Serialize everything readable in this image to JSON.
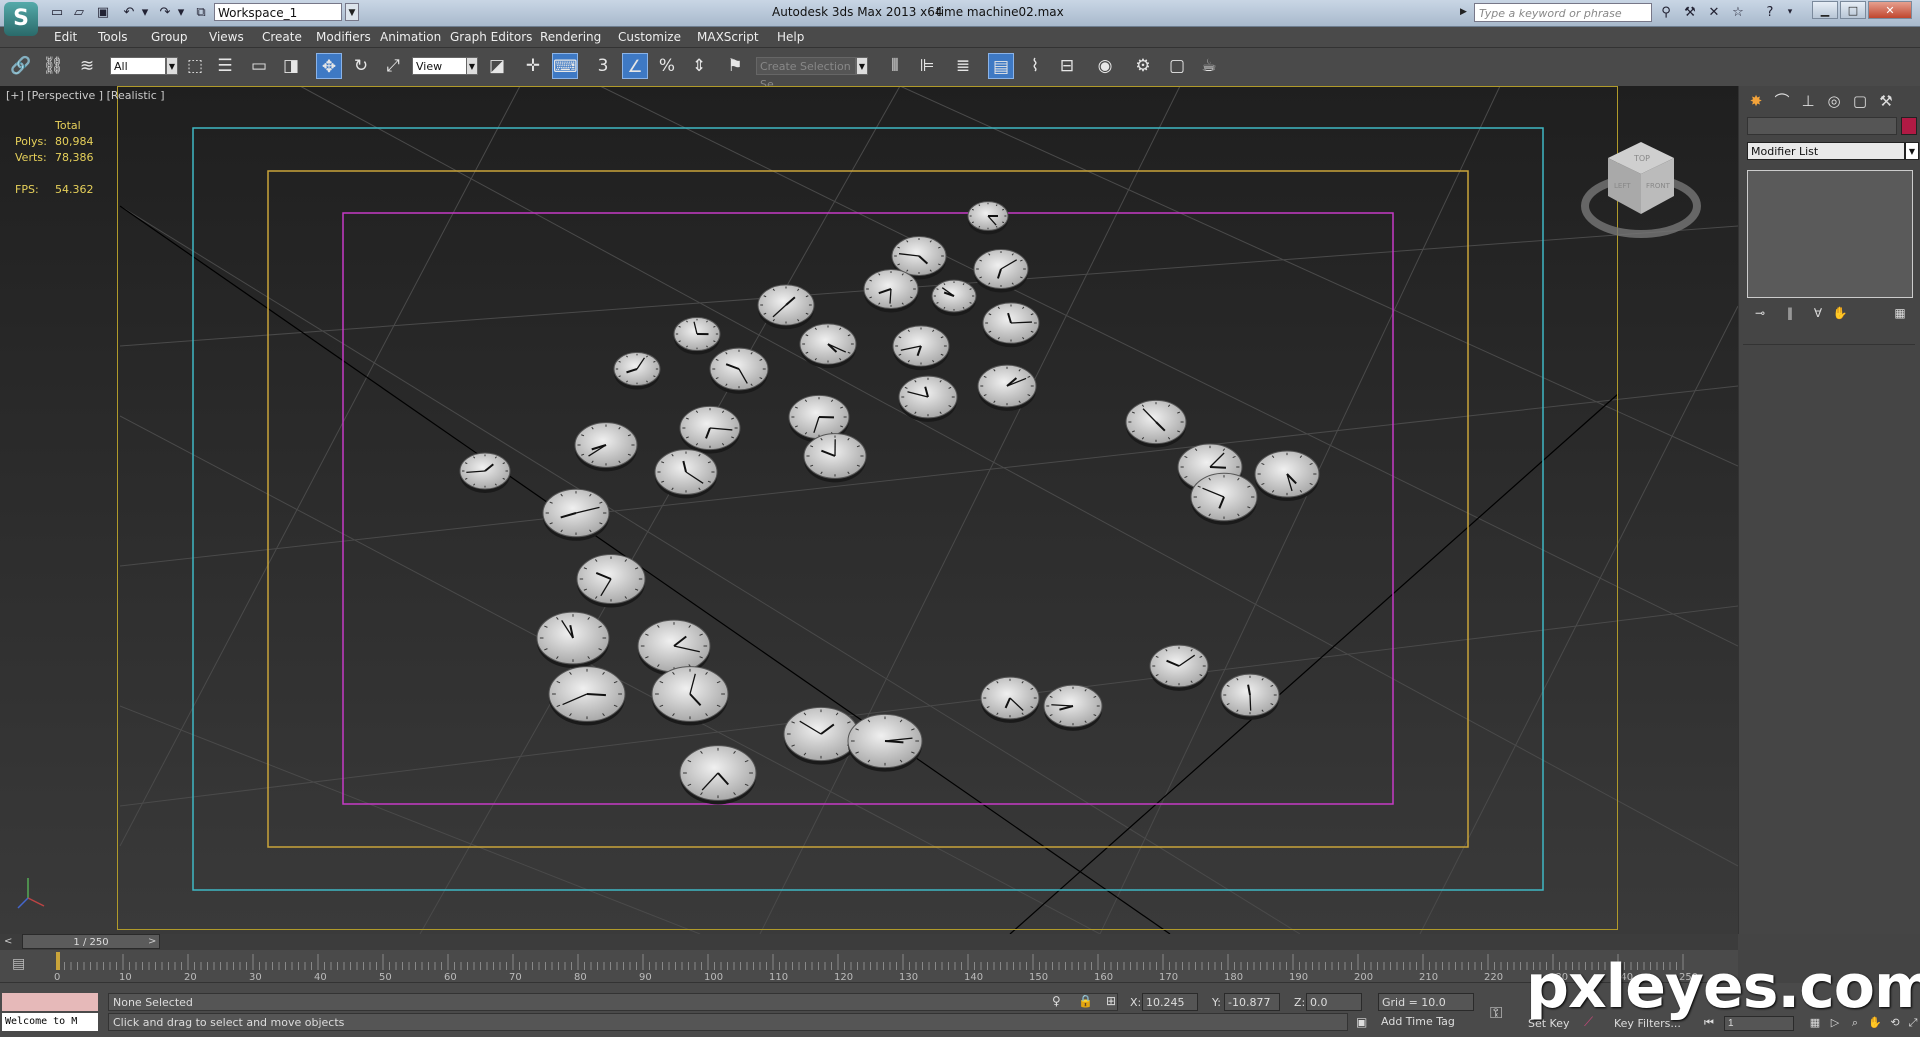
{
  "titlebar": {
    "workspace": "Workspace_1",
    "app_title": "Autodesk 3ds Max  2013 x64",
    "file_title": "time machine02.max",
    "search_placeholder": "Type a keyword or phrase"
  },
  "menu": [
    "Edit",
    "Tools",
    "Group",
    "Views",
    "Create",
    "Modifiers",
    "Animation",
    "Graph Editors",
    "Rendering",
    "Customize",
    "MAXScript",
    "Help"
  ],
  "toolbar": {
    "selection_filter": "All",
    "ref_coord": "View",
    "snap_angle_label": "3",
    "named_selection_placeholder": "Create Selection Se"
  },
  "viewport": {
    "label": "[+] [Perspective ] [Realistic ]",
    "stats": {
      "total_label": "Total",
      "polys_label": "Polys:",
      "polys_value": "80,984",
      "verts_label": "Verts:",
      "verts_value": "78,386",
      "fps_label": "FPS:",
      "fps_value": "54.362"
    },
    "viewcube": {
      "top": "TOP",
      "left": "LEFT",
      "front": "FRONT"
    }
  },
  "command_panel": {
    "modifier_list": "Modifier List"
  },
  "time_slider": {
    "position": "1 / 250",
    "prev": "<",
    "next": ">"
  },
  "trackbar": {
    "ticks": [
      "0",
      "10",
      "20",
      "30",
      "40",
      "50",
      "60",
      "70",
      "80",
      "90",
      "100",
      "110",
      "120",
      "130",
      "140",
      "150",
      "160",
      "170",
      "180",
      "190",
      "200",
      "210",
      "220",
      "230",
      "240",
      "250"
    ]
  },
  "status": {
    "listener_text": "Welcome to M",
    "selection": "None Selected",
    "prompt": "Click and drag to select and move objects",
    "x_label": "X:",
    "x_value": "10.245",
    "y_label": "Y:",
    "y_value": "-10.877",
    "z_label": "Z:",
    "z_value": "0.0",
    "grid": "Grid = 10.0",
    "add_time_tag": "Add Time Tag",
    "set_key": "Set Key",
    "key_filters": "Key Filters...",
    "current_frame": "1"
  },
  "watermark": "pxleyes.com",
  "colors": {
    "safe_frame_outer": "#3fb7c4",
    "safe_frame_mid": "#c9a43a",
    "safe_frame_inner": "#c63ac6",
    "stats_text": "#e6d05a",
    "object_color": "#b01a44",
    "active_tool": "#3e79c4"
  }
}
